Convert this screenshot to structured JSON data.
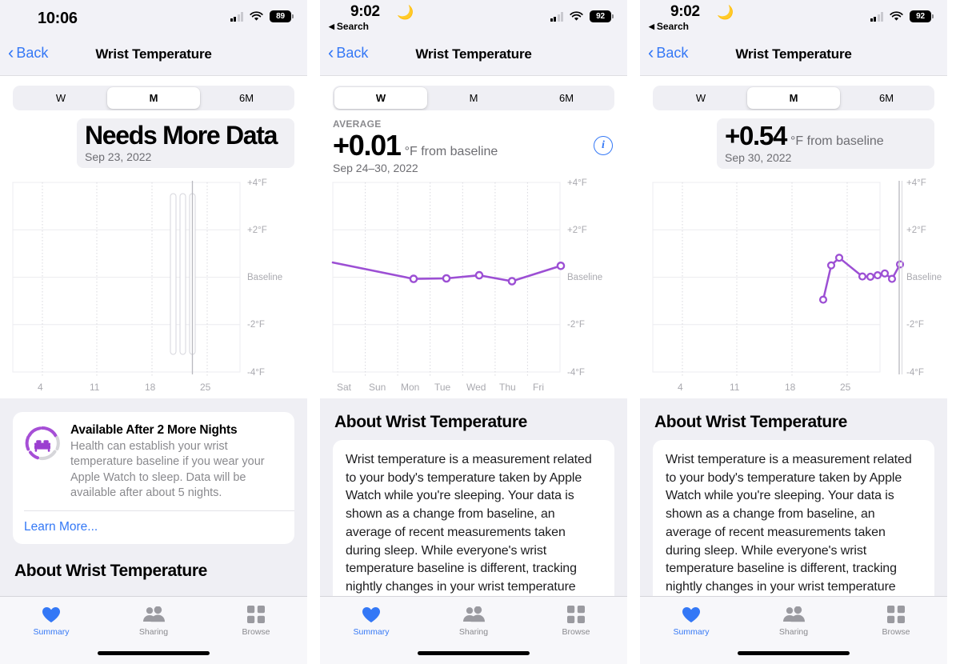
{
  "panels": [
    {
      "id": "panel-month-needs-data",
      "statusbar": {
        "time": "10:06",
        "moon": false,
        "return_label": "",
        "battery": "89"
      },
      "nav": {
        "back_label": "Back",
        "title": "Wrist Temperature"
      },
      "segmented": {
        "options": [
          "W",
          "M",
          "6M"
        ],
        "selected": "M"
      },
      "headline": {
        "style": "pill",
        "label": "",
        "value": "Needs More Data",
        "unit": "",
        "date": "Sep 23, 2022",
        "info_icon": false
      },
      "chart_data": {
        "type": "bar",
        "title": "Wrist Temperature — Month",
        "xlabel": "",
        "ylabel": "°F from baseline",
        "ylim": [
          -4,
          4
        ],
        "ytick_labels": [
          "+4°F",
          "+2°F",
          "Baseline",
          "-2°F",
          "-4°F"
        ],
        "ytick_values": [
          4,
          2,
          0,
          -2,
          -4
        ],
        "xtick_labels": [
          "4",
          "11",
          "18",
          "25"
        ],
        "xtick_values": [
          4,
          11,
          18,
          25
        ],
        "grid": true,
        "legend": "none",
        "note": "three no-data range bars spanning full axis; selection on the third",
        "bars": [
          {
            "day": 20,
            "low": -3.55,
            "high": 3.4
          },
          {
            "day": 21,
            "low": -3.55,
            "high": 3.4
          },
          {
            "day": 23,
            "low": -3.55,
            "high": 3.4
          }
        ],
        "selected_day": 23
      },
      "card": {
        "icon": "bed-ring-icon",
        "title": "Available After 2 More Nights",
        "body": "Health can establish your wrist temperature baseline if you wear your Apple Watch to sleep. Data will be available after about 5 nights.",
        "link": "Learn More..."
      },
      "about": {
        "heading": "About Wrist Temperature",
        "text": ""
      }
    },
    {
      "id": "panel-week-average",
      "statusbar": {
        "time": "9:02",
        "moon": true,
        "return_label": "Search",
        "battery": "92"
      },
      "nav": {
        "back_label": "Back",
        "title": "Wrist Temperature"
      },
      "segmented": {
        "options": [
          "W",
          "M",
          "6M"
        ],
        "selected": "W"
      },
      "headline": {
        "style": "plain",
        "label": "AVERAGE",
        "value": "+0.01",
        "unit": "°F from baseline",
        "date": "Sep 24–30, 2022",
        "info_icon": true
      },
      "chart_data": {
        "type": "line",
        "title": "Wrist Temperature — Week",
        "xlabel": "",
        "ylabel": "°F from baseline",
        "ylim": [
          -4,
          4
        ],
        "ytick_labels": [
          "+4°F",
          "+2°F",
          "Baseline",
          "-2°F",
          "-4°F"
        ],
        "ytick_values": [
          4,
          2,
          0,
          -2,
          -4
        ],
        "xtick_labels": [
          "Sat",
          "Sun",
          "Mon",
          "Tue",
          "Wed",
          "Thu",
          "Fri"
        ],
        "grid": true,
        "legend": "none",
        "series": [
          {
            "name": "Wrist temperature change",
            "color": "#9c4fd4",
            "x": [
              "Sat",
              "Sun",
              "Mon",
              "Tue",
              "Wed",
              "Thu",
              "Fri"
            ],
            "values": [
              0.62,
              null,
              -0.07,
              -0.05,
              0.08,
              -0.17,
              0.48
            ],
            "markers": [
              false,
              false,
              true,
              true,
              true,
              true,
              true
            ]
          }
        ]
      },
      "about": {
        "heading": "About Wrist Temperature",
        "text": "Wrist temperature is a measurement related to your body's temperature taken by Apple Watch while you're sleeping. Your data is shown as a change from baseline, an average of recent measurements taken during sleep. While everyone's wrist temperature baseline is different, tracking nightly changes in your wrist temperature"
      }
    },
    {
      "id": "panel-month-value",
      "statusbar": {
        "time": "9:02",
        "moon": true,
        "return_label": "Search",
        "battery": "92"
      },
      "nav": {
        "back_label": "Back",
        "title": "Wrist Temperature"
      },
      "segmented": {
        "options": [
          "W",
          "M",
          "6M"
        ],
        "selected": "M"
      },
      "headline": {
        "style": "pill",
        "label": "",
        "value": "+0.54",
        "unit": "°F from baseline",
        "date": "Sep 30, 2022",
        "info_icon": false
      },
      "chart_data": {
        "type": "line",
        "title": "Wrist Temperature — Month",
        "xlabel": "",
        "ylabel": "°F from baseline",
        "ylim": [
          -4,
          4
        ],
        "ytick_labels": [
          "+4°F",
          "+2°F",
          "Baseline",
          "-2°F",
          "-4°F"
        ],
        "ytick_values": [
          4,
          2,
          0,
          -2,
          -4
        ],
        "xtick_labels": [
          "4",
          "11",
          "18",
          "25"
        ],
        "xtick_values": [
          4,
          11,
          18,
          25
        ],
        "grid": true,
        "legend": "none",
        "selected_day": 30,
        "series": [
          {
            "name": "Wrist temperature change",
            "color": "#9c4fd4",
            "x": [
              20,
              21,
              22,
              25,
              26,
              27,
              28,
              29,
              30
            ],
            "values": [
              -0.95,
              0.5,
              0.82,
              0.03,
              0.02,
              0.08,
              0.16,
              -0.07,
              0.54
            ]
          }
        ]
      },
      "about": {
        "heading": "About Wrist Temperature",
        "text": "Wrist temperature is a measurement related to your body's temperature taken by Apple Watch while you're sleeping. Your data is shown as a change from baseline, an average of recent measurements taken during sleep. While everyone's wrist temperature baseline is different, tracking nightly changes in your wrist temperature"
      }
    }
  ],
  "tabbar": {
    "tabs": [
      {
        "label": "Summary",
        "icon": "heart-icon",
        "active": true
      },
      {
        "label": "Sharing",
        "icon": "people-icon",
        "active": false
      },
      {
        "label": "Browse",
        "icon": "grid-icon",
        "active": false
      }
    ]
  },
  "colors": {
    "accent_blue": "#3478f6",
    "chart_purple": "#9c4fd4",
    "muted_gray": "#8a8a8e",
    "panel_bg": "#efeff4"
  }
}
